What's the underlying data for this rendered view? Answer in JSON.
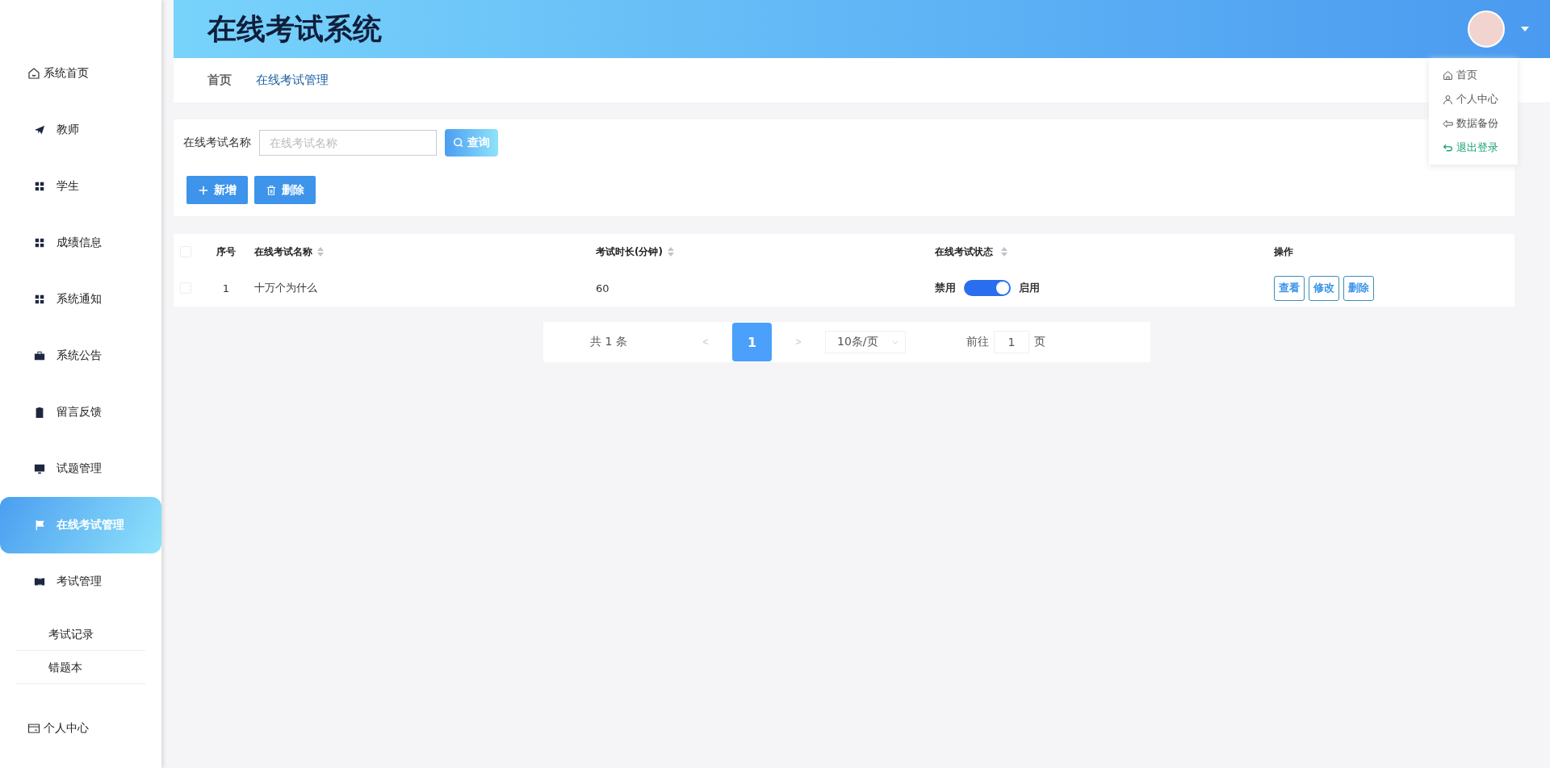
{
  "header": {
    "title": "在线考试系统"
  },
  "user_menu": [
    {
      "label": "首页",
      "highlighted": false
    },
    {
      "label": "个人中心",
      "highlighted": false
    },
    {
      "label": "数据备份",
      "highlighted": false
    },
    {
      "label": "退出登录",
      "highlighted": true
    }
  ],
  "sidebar": {
    "items": [
      {
        "label": "系统首页",
        "selected": false,
        "kind": "top"
      },
      {
        "label": "教师",
        "selected": false,
        "kind": "main"
      },
      {
        "label": "学生",
        "selected": false,
        "kind": "main"
      },
      {
        "label": "成绩信息",
        "selected": false,
        "kind": "main"
      },
      {
        "label": "系统通知",
        "selected": false,
        "kind": "main"
      },
      {
        "label": "系统公告",
        "selected": false,
        "kind": "main"
      },
      {
        "label": "留言反馈",
        "selected": false,
        "kind": "main"
      },
      {
        "label": "试题管理",
        "selected": false,
        "kind": "main"
      },
      {
        "label": "在线考试管理",
        "selected": true,
        "kind": "main"
      },
      {
        "label": "考试管理",
        "selected": false,
        "kind": "main",
        "children": [
          {
            "label": "考试记录"
          },
          {
            "label": "错题本"
          }
        ]
      },
      {
        "label": "个人中心",
        "selected": false,
        "kind": "top"
      }
    ]
  },
  "breadcrumb": [
    {
      "label": "首页",
      "selected": false
    },
    {
      "label": "在线考试管理",
      "selected": true
    }
  ],
  "search": {
    "label": "在线考试名称",
    "placeholder": "在线考试名称",
    "button": "查询"
  },
  "actions": [
    {
      "label": "新增"
    },
    {
      "label": "删除"
    }
  ],
  "table": {
    "columns": [
      {
        "label": "序号",
        "sortable": false
      },
      {
        "label": "在线考试名称",
        "sortable": true
      },
      {
        "label": "考试时长(分钟)",
        "sortable": true
      },
      {
        "label": "在线考试状态",
        "sortable": true
      },
      {
        "label": "操作",
        "sortable": false
      }
    ],
    "header_checked": false,
    "rows": [
      {
        "checked": false,
        "index": "1",
        "name": "十万个为什么",
        "duration": "60",
        "status": {
          "off_label": "禁用",
          "on_label": "启用",
          "on": true
        },
        "buttons": [
          "查看",
          "修改",
          "删除"
        ]
      }
    ]
  },
  "pagination": {
    "total": "共 1 条",
    "prev": "<",
    "pages": [
      {
        "label": "1",
        "selected": true
      }
    ],
    "next": ">",
    "page_size": "10条/页",
    "goto_label": "前往",
    "goto_value": "1",
    "goto_suffix": "页"
  }
}
